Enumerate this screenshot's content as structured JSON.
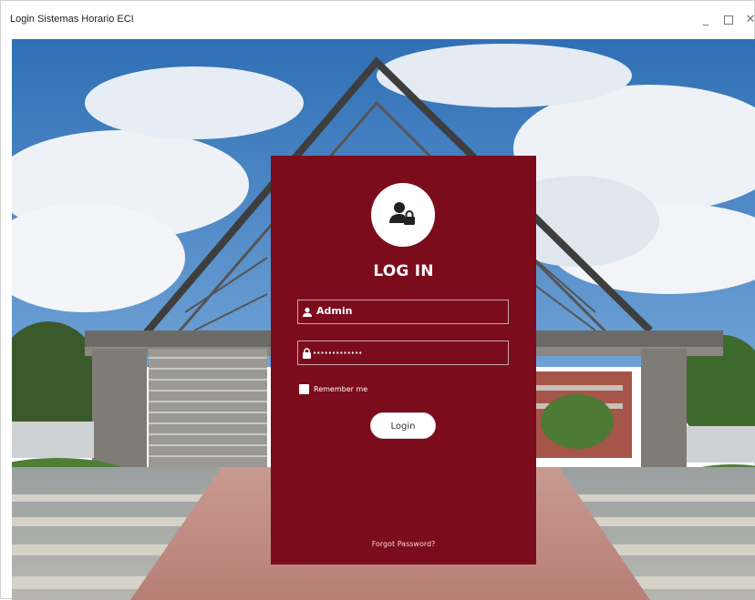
{
  "window": {
    "title": "Login Sistemas Horario ECI",
    "minimize": "_",
    "close": "✕"
  },
  "login": {
    "heading": "LOG IN",
    "username": "Admin",
    "password_mask": "·············",
    "remember_label": "Remember me",
    "login_button": "Login",
    "forgot_link": "Forgot Password?"
  },
  "colors": {
    "card": "#7b0c1c",
    "sky": "#4a86c4"
  },
  "icons": {
    "avatar": "user-lock-icon",
    "user": "user-icon",
    "password": "lock-icon"
  }
}
